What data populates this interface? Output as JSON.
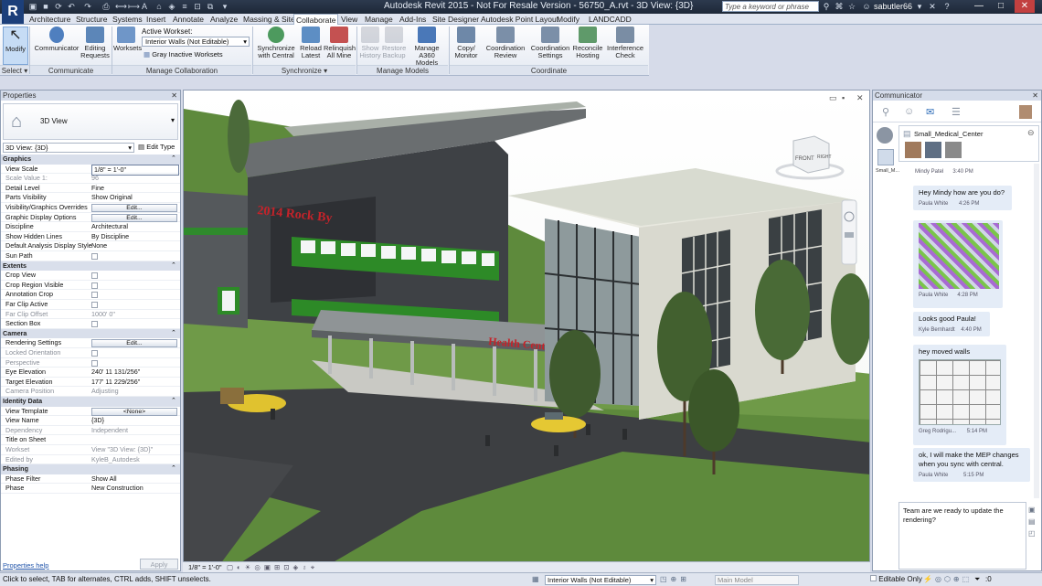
{
  "window": {
    "title": "Autodesk Revit 2015 - Not For Resale Version -  56750_A.rvt - 3D View: {3D}",
    "search_placeholder": "Type a keyword or phrase",
    "user": "sabutler66"
  },
  "tabs": [
    "Architecture",
    "Structure",
    "Systems",
    "Insert",
    "Annotate",
    "Analyze",
    "Massing & Site",
    "Collaborate",
    "View",
    "Manage",
    "Add-Ins",
    "Site Designer",
    "Autodesk Point Layout",
    "Modify",
    "LANDCADD"
  ],
  "active_tab": "Collaborate",
  "ribbon": {
    "modify": "Modify",
    "select": "Select ▾",
    "communicator": "Communicator",
    "editing_requests": "Editing Requests",
    "communicate_panel": "Communicate",
    "worksets": "Worksets",
    "active_workset_label": "Active Workset:",
    "active_workset_value": "Interior Walls (Not Editable)",
    "gray_inactive": "Gray Inactive Worksets",
    "manage_collab_panel": "Manage Collaboration",
    "sync_central": "Synchronize with Central",
    "reload_latest": "Reload Latest",
    "relinquish": "Relinquish All Mine",
    "synchronize_panel": "Synchronize ▾",
    "show_history": "Show History",
    "restore_backup": "Restore Backup",
    "manage_a360": "Manage A360 Models",
    "manage_models_panel": "Manage Models",
    "copy_monitor": "Copy/ Monitor",
    "coordination_review": "Coordination Review",
    "coordination_settings": "Coordination Settings",
    "reconcile_hosting": "Reconcile Hosting",
    "interference_check": "Interference Check",
    "coordinate_panel": "Coordinate"
  },
  "properties": {
    "title": "Properties",
    "type_name": "3D View",
    "instance": "3D View: {3D}",
    "edit_type": "Edit Type",
    "groups": {
      "graphics": "Graphics",
      "extents": "Extents",
      "camera": "Camera",
      "identity": "Identity Data",
      "phasing": "Phasing"
    },
    "rows": {
      "view_scale": [
        "View Scale",
        "1/8\" = 1'-0\""
      ],
      "scale_value": [
        "Scale Value    1:",
        "96"
      ],
      "detail_level": [
        "Detail Level",
        "Fine"
      ],
      "parts_visibility": [
        "Parts Visibility",
        "Show Original"
      ],
      "vg_overrides": [
        "Visibility/Graphics Overrides",
        "Edit..."
      ],
      "graphic_display": [
        "Graphic Display Options",
        "Edit..."
      ],
      "discipline": [
        "Discipline",
        "Architectural"
      ],
      "hidden_lines": [
        "Show Hidden Lines",
        "By Discipline"
      ],
      "analysis_style": [
        "Default Analysis Display Style",
        "None"
      ],
      "sun_path": [
        "Sun Path",
        ""
      ],
      "crop_view": [
        "Crop View",
        ""
      ],
      "crop_region": [
        "Crop Region Visible",
        ""
      ],
      "annotation_crop": [
        "Annotation Crop",
        ""
      ],
      "far_clip_active": [
        "Far Clip Active",
        ""
      ],
      "far_clip_offset": [
        "Far Clip Offset",
        "1000'  0\""
      ],
      "section_box": [
        "Section Box",
        ""
      ],
      "rendering": [
        "Rendering Settings",
        "Edit..."
      ],
      "locked_orientation": [
        "Locked Orientation",
        ""
      ],
      "perspective": [
        "Perspective",
        ""
      ],
      "eye_elevation": [
        "Eye Elevation",
        "240'  11 131/256\""
      ],
      "target_elevation": [
        "Target Elevation",
        "177'  11 229/256\""
      ],
      "camera_position": [
        "Camera Position",
        "Adjusting"
      ],
      "view_template": [
        "View Template",
        "<None>"
      ],
      "view_name": [
        "View Name",
        "{3D}"
      ],
      "dependency": [
        "Dependency",
        "Independent"
      ],
      "title_sheet": [
        "Title on Sheet",
        ""
      ],
      "workset": [
        "Workset",
        "View \"3D View: {3D}\""
      ],
      "edited_by": [
        "Edited by",
        "KyleB_Autodesk"
      ],
      "phase_filter": [
        "Phase Filter",
        "Show All"
      ],
      "phase": [
        "Phase",
        "New Construction"
      ]
    },
    "help": "Properties help",
    "apply": "Apply"
  },
  "viewport": {
    "scale": "1/8\" = 1'-0\"",
    "sign_top": "2014 Rock By",
    "sign_canopy": "Health Center",
    "cube_front": "FRONT",
    "cube_right": "RIGHT"
  },
  "communicator": {
    "title": "Communicator",
    "project": "Small_Medical_Center",
    "side_label": "Small_M...",
    "messages": [
      {
        "text": "",
        "author": "Mindy Patel",
        "time": "3:40 PM"
      },
      {
        "text": "Hey Mindy how are you do?",
        "author": "Paula White",
        "time": "4:26 PM"
      },
      {
        "text": "",
        "author": "Paula White",
        "time": "4:28 PM",
        "image": "3d-model-screenshot"
      },
      {
        "text": "Looks good Paula!",
        "author": "Kyle Bernhardt",
        "time": "4:40 PM"
      },
      {
        "text": "hey moved walls",
        "author": "Greg Rodrigu...",
        "time": "5:14 PM",
        "image": "floor-plan-screenshot"
      },
      {
        "text": "ok, I will make the MEP changes when you sync with central.",
        "author": "Paula White",
        "time": "5:15 PM"
      }
    ],
    "draft": "Team are we ready to update the rendering?"
  },
  "status": {
    "hint": "Click to select, TAB for alternates, CTRL adds, SHIFT unselects.",
    "workset": "Interior Walls (Not Editable)",
    "model": "Main Model",
    "editable_only": "Editable Only",
    "count": ":0"
  }
}
